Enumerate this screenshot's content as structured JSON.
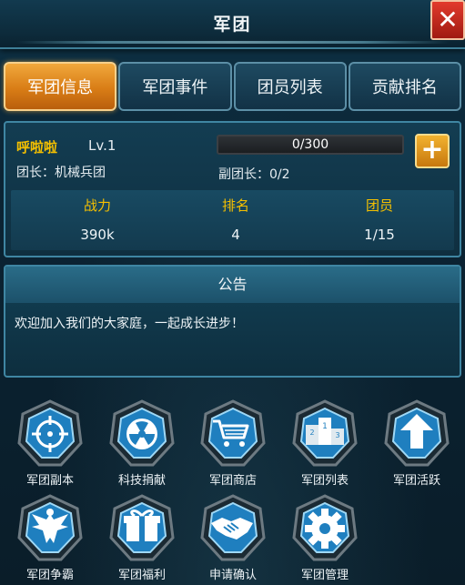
{
  "window": {
    "title": "军团",
    "close_icon": "close-icon"
  },
  "tabs": [
    {
      "label": "军团信息",
      "active": true
    },
    {
      "label": "军团事件",
      "active": false
    },
    {
      "label": "团员列表",
      "active": false
    },
    {
      "label": "贡献排名",
      "active": false
    }
  ],
  "legion": {
    "name": "呼啦啦",
    "level": "Lv.1",
    "leader": "团长：机械兵团",
    "vice_leader": "副团长：0/2",
    "progress_text": "0/300",
    "progress_fraction": 0,
    "add_icon": "plus-icon"
  },
  "stats": [
    {
      "label": "战力",
      "value": "390k"
    },
    {
      "label": "排名",
      "value": "4"
    },
    {
      "label": "团员",
      "value": "1/15"
    }
  ],
  "notice": {
    "header": "公告",
    "text": "欢迎加入我们的大家庭，一起成长进步！"
  },
  "features": [
    {
      "label": "军团副本",
      "icon": "crosshair-icon"
    },
    {
      "label": "科技捐献",
      "icon": "radiation-icon"
    },
    {
      "label": "军团商店",
      "icon": "shopping-cart-icon"
    },
    {
      "label": "军团列表",
      "icon": "podium-icon"
    },
    {
      "label": "军团活跃",
      "icon": "up-arrow-icon"
    },
    {
      "label": "军团争霸",
      "icon": "eagle-icon"
    },
    {
      "label": "军团福利",
      "icon": "gift-icon"
    },
    {
      "label": "申请确认",
      "icon": "handshake-icon"
    },
    {
      "label": "军团管理",
      "icon": "gear-icon"
    }
  ],
  "colors": {
    "gold_text": "#f5c000",
    "tab_active": "#e08a1e",
    "panel_border": "#3f86a3",
    "close_red": "#d0281c"
  }
}
